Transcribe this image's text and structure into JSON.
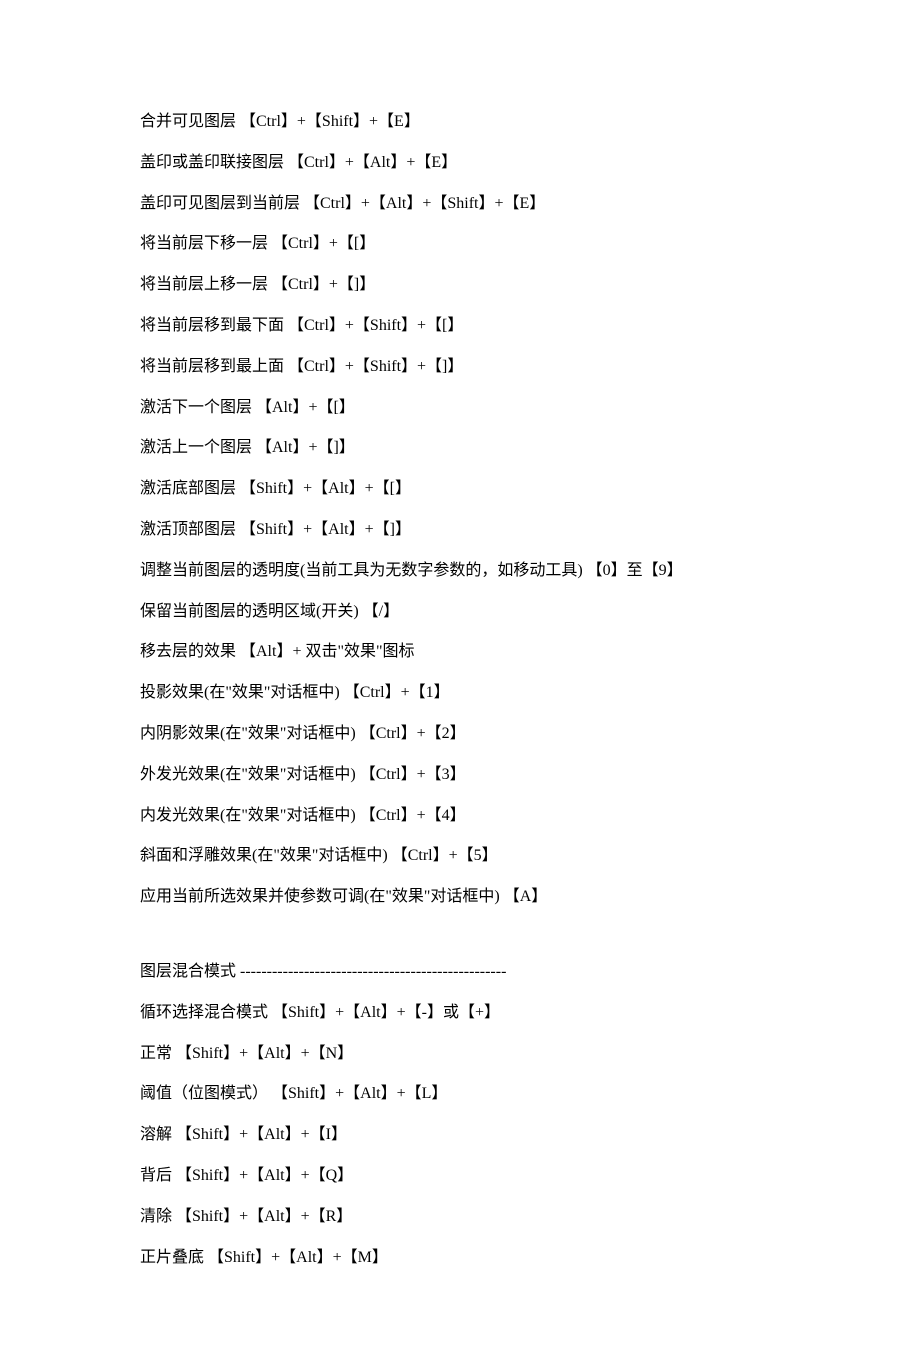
{
  "lines_block1": [
    "合并可见图层 【Ctrl】+【Shift】+【E】",
    "盖印或盖印联接图层 【Ctrl】+【Alt】+【E】",
    "盖印可见图层到当前层 【Ctrl】+【Alt】+【Shift】+【E】",
    "将当前层下移一层 【Ctrl】+【[】",
    "将当前层上移一层 【Ctrl】+【]】",
    "将当前层移到最下面 【Ctrl】+【Shift】+【[】",
    "将当前层移到最上面 【Ctrl】+【Shift】+【]】",
    "激活下一个图层 【Alt】+【[】",
    "激活上一个图层 【Alt】+【]】",
    "激活底部图层 【Shift】+【Alt】+【[】",
    "激活顶部图层 【Shift】+【Alt】+【]】",
    "调整当前图层的透明度(当前工具为无数字参数的，如移动工具) 【0】至【9】",
    "保留当前图层的透明区域(开关) 【/】",
    "移去层的效果 【Alt】+ 双击\"效果\"图标",
    "投影效果(在\"效果\"对话框中) 【Ctrl】+【1】",
    "内阴影效果(在\"效果\"对话框中) 【Ctrl】+【2】",
    "外发光效果(在\"效果\"对话框中) 【Ctrl】+【3】",
    "内发光效果(在\"效果\"对话框中) 【Ctrl】+【4】",
    "斜面和浮雕效果(在\"效果\"对话框中) 【Ctrl】+【5】",
    "应用当前所选效果并使参数可调(在\"效果\"对话框中) 【A】"
  ],
  "lines_block2": [
    "图层混合模式 --------------------------------------------------",
    "循环选择混合模式 【Shift】+【Alt】+【-】或【+】",
    "正常 【Shift】+【Alt】+【N】",
    "阈值（位图模式） 【Shift】+【Alt】+【L】",
    "溶解 【Shift】+【Alt】+【I】",
    "背后 【Shift】+【Alt】+【Q】",
    "清除 【Shift】+【Alt】+【R】",
    "正片叠底 【Shift】+【Alt】+【M】"
  ]
}
